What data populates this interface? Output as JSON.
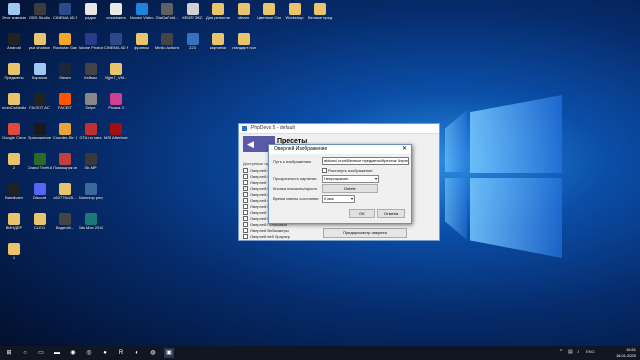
{
  "desktop": {
    "icons": [
      {
        "label": "Этот компьютер",
        "color": "#9fc7ef"
      },
      {
        "label": "OBS Studio",
        "color": "#3c3c3c"
      },
      {
        "label": "CINEMA 4D R14",
        "color": "#2a4a8a"
      },
      {
        "label": "радио",
        "color": "#e6e6e6"
      },
      {
        "label": "cmoshaers",
        "color": "#e8e8e8"
      },
      {
        "label": "Movavi Video Editor Plus",
        "color": "#1f83d8"
      },
      {
        "label": "GtaGaFold...",
        "color": "#606060"
      },
      {
        "label": "КЕМП ЭКС",
        "color": "#d0d0d0"
      },
      {
        "label": "Для репостинга",
        "color": "#e9c46a"
      },
      {
        "label": "steam",
        "color": "#e9c46a"
      },
      {
        "label": "Цветные Схемы...",
        "color": "#e9c46a"
      },
      {
        "label": "Workshop",
        "color": "#e9c46a"
      },
      {
        "label": "Вечные предметы",
        "color": "#e9c46a"
      },
      {
        "label": "Android",
        "color": "#222222"
      },
      {
        "label": "psd shablon",
        "color": "#e9c46a"
      },
      {
        "label": "Rockstar Games...",
        "color": "#f5a623"
      },
      {
        "label": "Adobe Photosh...",
        "color": "#2a3a8a"
      },
      {
        "label": "CINEMA 4D R14 64BIT",
        "color": "#2a4a8a"
      },
      {
        "label": "фрапсы",
        "color": "#e9c46a"
      },
      {
        "label": "Minilo Actions",
        "color": "#444"
      },
      {
        "label": "223",
        "color": "#3a70c0"
      },
      {
        "label": "картинки",
        "color": "#e9c46a"
      },
      {
        "label": "стандарт пользов",
        "color": "#e9c46a"
      },
      {
        "label": "Предметы",
        "color": "#e9c46a"
      },
      {
        "label": "Корзина",
        "color": "#9fc7ef"
      },
      {
        "label": "Steam",
        "color": "#1b2838"
      },
      {
        "label": "Кеймы",
        "color": "#444"
      },
      {
        "label": "Vijjer7_VM...",
        "color": "#e9c46a"
      },
      {
        "label": "mobiCsMedia",
        "color": "#e9c46a"
      },
      {
        "label": "FACEIT AC",
        "color": "#222"
      },
      {
        "label": "FACEIT",
        "color": "#ff5500"
      },
      {
        "label": "Snipe",
        "color": "#888"
      },
      {
        "label": "Picasa 3",
        "color": "#d04090"
      },
      {
        "label": "Google Chrome",
        "color": "#e04a3a"
      },
      {
        "label": "Приложение Autodesk д...",
        "color": "#1a1a1a"
      },
      {
        "label": "Counter-Str. Global Offe...",
        "color": "#e9a33a"
      },
      {
        "label": "GTA no cars",
        "color": "#c03030"
      },
      {
        "label": "MSI Afterburner",
        "color": "#a01010"
      },
      {
        "label": "2",
        "color": "#e9c46a"
      },
      {
        "label": "Grand Theft Auto V",
        "color": "#2a6a2a"
      },
      {
        "label": "Помощник игрокам...",
        "color": "#c04040"
      },
      {
        "label": "Sb-MP",
        "color": "#3a3a3a"
      },
      {
        "label": "Bandicam",
        "color": "#222"
      },
      {
        "label": "Discord",
        "color": "#5865f2"
      },
      {
        "label": "c62776c26...",
        "color": "#e9c46a"
      },
      {
        "label": "Монитор ресурсов",
        "color": "#3a6a9a"
      },
      {
        "label": "ВИНДЕР",
        "color": "#e9c46a"
      },
      {
        "label": "CLEO",
        "color": "#e9c46a"
      },
      {
        "label": "ВидеоМ...",
        "color": "#444"
      },
      {
        "label": "3ds Max 2016",
        "color": "#1a7a7a"
      },
      {
        "label": "1",
        "color": "#e9c46a"
      }
    ]
  },
  "back_window": {
    "title": "PhpDevs 5 - default",
    "header_title": "Пресеты",
    "list_label": "Доступные пресеты",
    "items": [
      {
        "label": "Оверлей Ф...",
        "checked": false
      },
      {
        "label": "Оверлей Ш...",
        "checked": false
      },
      {
        "label": "Оверлей Т...",
        "checked": false
      },
      {
        "label": "Оверлей В...",
        "checked": true
      },
      {
        "label": "Оверлей Ц...",
        "checked": false
      },
      {
        "label": "Оверлей Ф...",
        "checked": false
      },
      {
        "label": "Оверлей Р...",
        "checked": false
      },
      {
        "label": "Оверлей Т...",
        "checked": false
      },
      {
        "label": "Оверлей Горизонт",
        "checked": false
      },
      {
        "label": "Оверлей Голосовой",
        "checked": false
      },
      {
        "label": "Оверлей Вебкамеры",
        "checked": false
      },
      {
        "label": "Оверлей веб браузер",
        "checked": false
      }
    ],
    "preview_button": "Предпросмотр оверлея"
  },
  "dialog": {
    "title": "Оверлей Изображение",
    "close": "✕",
    "path_label": "Путь к изображению",
    "path_value": "ablcanl стол\\Вечные предметы\\Крестик Черно",
    "stretch_label": "Растянуть изображение",
    "opacity_label": "Прозрачность картинки",
    "opacity_value": "Непрозрачно",
    "hotkey_label": "Кнопка показать/скрыть",
    "hotkey_button": "Delete",
    "time_label": "Время смены состояния",
    "time_value": "0 мкс",
    "ok": "OK",
    "cancel": "Отмена"
  },
  "taskbar": {
    "time": "16:51",
    "date": "18.01.2020",
    "lang": "ENG",
    "apps": [
      "windows-logo",
      "search",
      "task-view",
      "explorer",
      "chrome",
      "steam",
      "bandicam",
      "rockstar",
      "discord",
      "obs",
      "phpdevs"
    ]
  }
}
